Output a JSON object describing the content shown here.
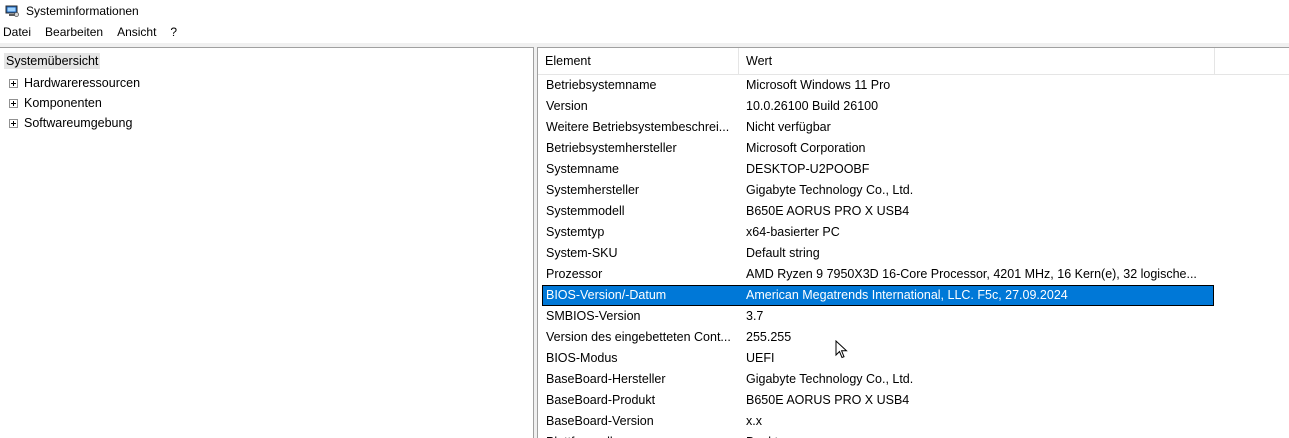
{
  "window": {
    "title": "Systeminformationen"
  },
  "menu": {
    "items": [
      "Datei",
      "Bearbeiten",
      "Ansicht",
      "?"
    ]
  },
  "tree": {
    "root": "Systemübersicht",
    "children": [
      "Hardwareressourcen",
      "Komponenten",
      "Softwareumgebung"
    ]
  },
  "list": {
    "columns": [
      "Element",
      "Wert"
    ],
    "selected_index": 10,
    "rows": [
      {
        "element": "Betriebsystemname",
        "value": "Microsoft Windows 11 Pro"
      },
      {
        "element": "Version",
        "value": "10.0.26100 Build 26100"
      },
      {
        "element": "Weitere Betriebsystembeschrei...",
        "value": "Nicht verfügbar"
      },
      {
        "element": "Betriebsystemhersteller",
        "value": "Microsoft Corporation"
      },
      {
        "element": "Systemname",
        "value": "DESKTOP-U2POOBF"
      },
      {
        "element": "Systemhersteller",
        "value": "Gigabyte Technology Co., Ltd."
      },
      {
        "element": "Systemmodell",
        "value": "B650E AORUS PRO X USB4"
      },
      {
        "element": "Systemtyp",
        "value": "x64-basierter PC"
      },
      {
        "element": "System-SKU",
        "value": "Default string"
      },
      {
        "element": "Prozessor",
        "value": "AMD Ryzen 9 7950X3D 16-Core Processor, 4201 MHz, 16 Kern(e), 32 logische..."
      },
      {
        "element": "BIOS-Version/-Datum",
        "value": "American Megatrends International, LLC. F5c, 27.09.2024"
      },
      {
        "element": "SMBIOS-Version",
        "value": "3.7"
      },
      {
        "element": "Version des eingebetteten Cont...",
        "value": "255.255"
      },
      {
        "element": "BIOS-Modus",
        "value": "UEFI"
      },
      {
        "element": "BaseBoard-Hersteller",
        "value": "Gigabyte Technology Co., Ltd."
      },
      {
        "element": "BaseBoard-Produkt",
        "value": "B650E AORUS PRO X USB4"
      },
      {
        "element": "BaseBoard-Version",
        "value": "x.x"
      },
      {
        "element": "Plattformrolle",
        "value": "Desktop"
      }
    ]
  },
  "colors": {
    "selection": "#0078d7",
    "pane_border": "#a0a0a0",
    "tree_root_highlight": "#e5e5e5"
  }
}
